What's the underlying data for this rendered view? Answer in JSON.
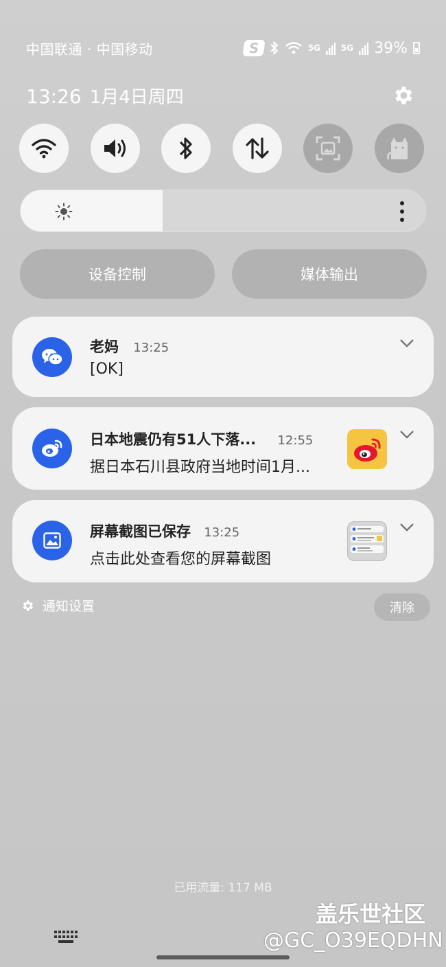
{
  "status_bar": {
    "carrier": "中国联通 · 中国移动",
    "network_5g_1": "5G",
    "network_5g_2": "5G",
    "battery": "39%",
    "icons": [
      "s-app-icon",
      "bluetooth-icon",
      "wifi-icon",
      "signal-icon",
      "signal-icon",
      "battery-icon"
    ]
  },
  "header": {
    "time": "13:26",
    "date": "1月4日周四"
  },
  "quick_settings": [
    {
      "name": "wifi",
      "icon": "wifi-icon",
      "on": true
    },
    {
      "name": "sound",
      "icon": "volume-icon",
      "on": true
    },
    {
      "name": "bluetooth",
      "icon": "bluetooth-icon",
      "on": true
    },
    {
      "name": "mobile-data",
      "icon": "data-transfer-icon",
      "on": true
    },
    {
      "name": "screen-capture",
      "icon": "screen-capture-icon",
      "on": false
    },
    {
      "name": "cat",
      "icon": "cat-icon",
      "on": false
    }
  ],
  "brightness": {
    "level": 0.35
  },
  "controls": {
    "device_control": "设备控制",
    "media_output": "媒体输出"
  },
  "notifications": [
    {
      "title": "老妈",
      "time": "13:25",
      "body": "[OK]",
      "app_icon": "wechat-icon"
    },
    {
      "title": "日本地震仍有51人下落...",
      "time": "12:55",
      "body": "据日本石川县政府当地时间1月...",
      "app_icon": "weibo-icon",
      "thumb": "weibo-logo"
    },
    {
      "title": "屏幕截图已保存",
      "time": "13:25",
      "body": "点击此处查看您的屏幕截图",
      "app_icon": "gallery-icon",
      "thumb": "screenshot-thumbnail"
    }
  ],
  "footer": {
    "notification_settings": "通知设置",
    "clear": "清除",
    "data_usage": "已用流量: 117 MB"
  },
  "watermark": {
    "site": "盖乐世社区",
    "user": "@GC_O39EQDHN"
  },
  "colors": {
    "accent_blue": "#2a62e8",
    "weibo_bg": "#f5c542",
    "weibo_red": "#e6162d"
  }
}
